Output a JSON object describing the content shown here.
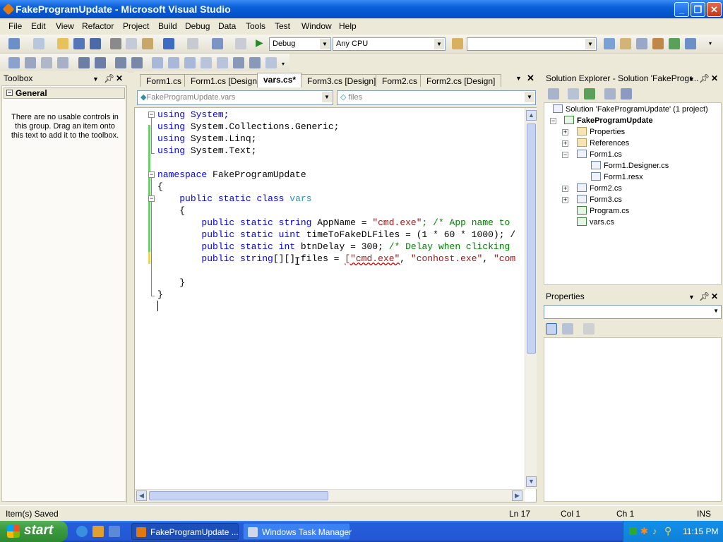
{
  "window": {
    "title": "FakeProgramUpdate - Microsoft Visual Studio"
  },
  "menu": [
    "File",
    "Edit",
    "View",
    "Refactor",
    "Project",
    "Build",
    "Debug",
    "Data",
    "Tools",
    "Test",
    "Window",
    "Help"
  ],
  "toolbar": {
    "config": "Debug",
    "platform": "Any CPU",
    "find": ""
  },
  "toolbox": {
    "title": "Toolbox",
    "group": "General",
    "message": "There are no usable controls in this group. Drag an item onto this text to add it to the toolbox."
  },
  "tabs": [
    "Form1.cs",
    "Form1.cs [Design]",
    "vars.cs*",
    "Form3.cs [Design]",
    "Form2.cs",
    "Form2.cs [Design]"
  ],
  "nav": {
    "type": "FakeProgramUpdate.vars",
    "member": "files"
  },
  "code": {
    "l1": "using System;",
    "l2": "using System.Collections.Generic;",
    "l3": "using System.Linq;",
    "l4": "using System.Text;",
    "l6": "namespace FakeProgramUpdate",
    "l7": "{",
    "l8": "public static class vars",
    "l9": "{",
    "l10a": "public static string AppName = ",
    "l10s": "\"cmd.exe\"",
    "l10c": "; /* App name to",
    "l11a": "public static uint timeToFakeDLFiles = (1 * 60 * 1000); /",
    "l12a": "public static int btnDelay = 300; ",
    "l12c": "/* Delay when clicking",
    "l13a": "public string[][] files = ",
    "l13s1": "[\"cmd.exe\"",
    "l13b": ", ",
    "l13s2": "\"conhost.exe\"",
    "l13c": ", ",
    "l13s3": "\"com",
    "l15": "}",
    "l16": "}"
  },
  "solution_explorer": {
    "title": "Solution Explorer - Solution 'FakeProgr...",
    "solution": "Solution 'FakeProgramUpdate' (1 project)",
    "project": "FakeProgramUpdate",
    "items": [
      "Properties",
      "References",
      "Form1.cs",
      "Form1.Designer.cs",
      "Form1.resx",
      "Form2.cs",
      "Form3.cs",
      "Program.cs",
      "vars.cs"
    ]
  },
  "properties": {
    "title": "Properties"
  },
  "status": {
    "message": "Item(s) Saved",
    "ln": "Ln 17",
    "col": "Col 1",
    "ch": "Ch 1",
    "mode": "INS"
  },
  "taskbar": {
    "start": "start",
    "tasks": [
      "FakeProgramUpdate ...",
      "Windows Task Manager"
    ],
    "clock": "11:15 PM"
  },
  "colors": {
    "titlebar": "#0a5fd8",
    "taskbar": "#245edb",
    "start": "#3c9a3f",
    "keyword": "#0000ff",
    "string": "#a31515",
    "comment": "#008000"
  }
}
